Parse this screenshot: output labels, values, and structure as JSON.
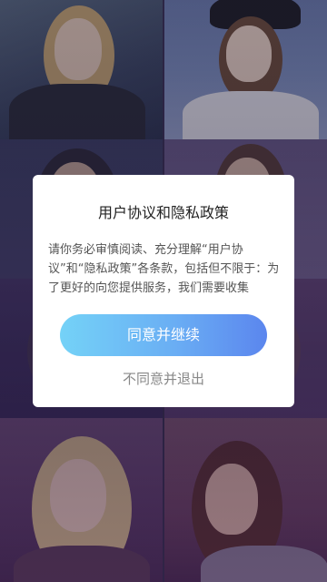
{
  "dialog": {
    "title": "用户协议和隐私政策",
    "body": "请你务必审慎阅读、充分理解“用户协议”和“隐私政策”各条款，包括但不限于：为了更好的向您提供服务，我们需要收集",
    "agree_label": "同意并继续",
    "disagree_label": "不同意并退出"
  },
  "colors": {
    "agree_gradient_start": "#74d2f7",
    "agree_gradient_end": "#5b86ee",
    "dialog_bg": "#ffffff",
    "title_color": "#222222",
    "body_color": "#555555",
    "disagree_color": "#888888"
  }
}
